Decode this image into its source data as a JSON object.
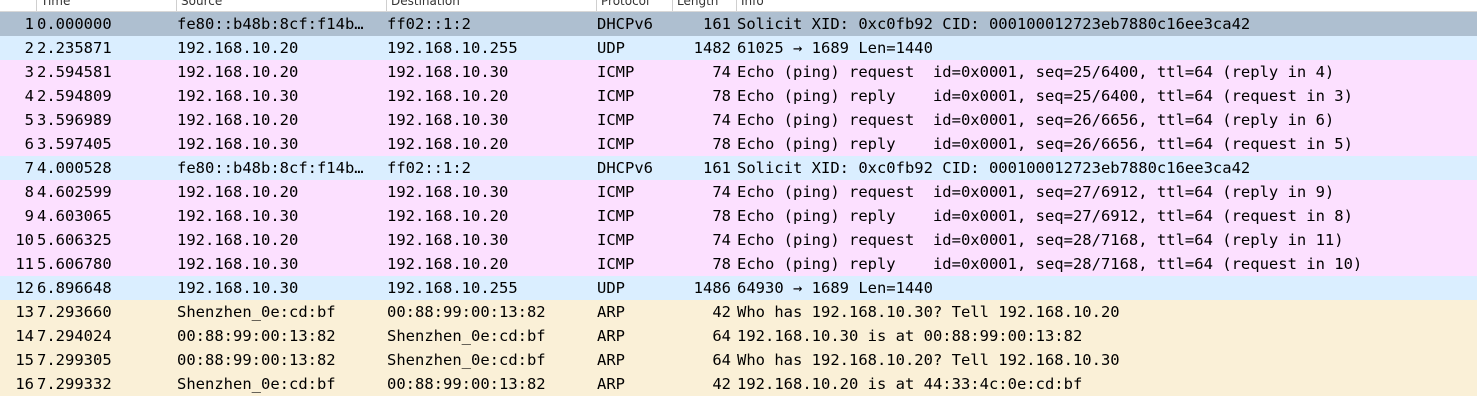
{
  "colors": {
    "dhcpv6_selected": "#aebfd0",
    "udp": "#daeeff",
    "icmp": "#fce0ff",
    "arp": "#faf0d7"
  },
  "columns": [
    "Time",
    "Source",
    "Destination",
    "Protocol",
    "Length",
    "Info"
  ],
  "rows": [
    {
      "no": "1",
      "time": "0.000000",
      "src": "fe80::b48b:8cf:f14b…",
      "dst": "ff02::1:2",
      "proto": "DHCPv6",
      "len": "161",
      "info": "Solicit XID: 0xc0fb92 CID: 000100012723eb7880c16ee3ca42",
      "color": "#aebfd0"
    },
    {
      "no": "2",
      "time": "2.235871",
      "src": "192.168.10.20",
      "dst": "192.168.10.255",
      "proto": "UDP",
      "len": "1482",
      "info": "61025 → 1689 Len=1440",
      "color": "#daeeff"
    },
    {
      "no": "3",
      "time": "2.594581",
      "src": "192.168.10.20",
      "dst": "192.168.10.30",
      "proto": "ICMP",
      "len": "74",
      "info": "Echo (ping) request  id=0x0001, seq=25/6400, ttl=64 (reply in 4)",
      "color": "#fce0ff"
    },
    {
      "no": "4",
      "time": "2.594809",
      "src": "192.168.10.30",
      "dst": "192.168.10.20",
      "proto": "ICMP",
      "len": "78",
      "info": "Echo (ping) reply    id=0x0001, seq=25/6400, ttl=64 (request in 3)",
      "color": "#fce0ff"
    },
    {
      "no": "5",
      "time": "3.596989",
      "src": "192.168.10.20",
      "dst": "192.168.10.30",
      "proto": "ICMP",
      "len": "74",
      "info": "Echo (ping) request  id=0x0001, seq=26/6656, ttl=64 (reply in 6)",
      "color": "#fce0ff"
    },
    {
      "no": "6",
      "time": "3.597405",
      "src": "192.168.10.30",
      "dst": "192.168.10.20",
      "proto": "ICMP",
      "len": "78",
      "info": "Echo (ping) reply    id=0x0001, seq=26/6656, ttl=64 (request in 5)",
      "color": "#fce0ff"
    },
    {
      "no": "7",
      "time": "4.000528",
      "src": "fe80::b48b:8cf:f14b…",
      "dst": "ff02::1:2",
      "proto": "DHCPv6",
      "len": "161",
      "info": "Solicit XID: 0xc0fb92 CID: 000100012723eb7880c16ee3ca42",
      "color": "#daeeff"
    },
    {
      "no": "8",
      "time": "4.602599",
      "src": "192.168.10.20",
      "dst": "192.168.10.30",
      "proto": "ICMP",
      "len": "74",
      "info": "Echo (ping) request  id=0x0001, seq=27/6912, ttl=64 (reply in 9)",
      "color": "#fce0ff"
    },
    {
      "no": "9",
      "time": "4.603065",
      "src": "192.168.10.30",
      "dst": "192.168.10.20",
      "proto": "ICMP",
      "len": "78",
      "info": "Echo (ping) reply    id=0x0001, seq=27/6912, ttl=64 (request in 8)",
      "color": "#fce0ff"
    },
    {
      "no": "10",
      "time": "5.606325",
      "src": "192.168.10.20",
      "dst": "192.168.10.30",
      "proto": "ICMP",
      "len": "74",
      "info": "Echo (ping) request  id=0x0001, seq=28/7168, ttl=64 (reply in 11)",
      "color": "#fce0ff"
    },
    {
      "no": "11",
      "time": "5.606780",
      "src": "192.168.10.30",
      "dst": "192.168.10.20",
      "proto": "ICMP",
      "len": "78",
      "info": "Echo (ping) reply    id=0x0001, seq=28/7168, ttl=64 (request in 10)",
      "color": "#fce0ff"
    },
    {
      "no": "12",
      "time": "6.896648",
      "src": "192.168.10.30",
      "dst": "192.168.10.255",
      "proto": "UDP",
      "len": "1486",
      "info": "64930 → 1689 Len=1440",
      "color": "#daeeff"
    },
    {
      "no": "13",
      "time": "7.293660",
      "src": "Shenzhen_0e:cd:bf",
      "dst": "00:88:99:00:13:82",
      "proto": "ARP",
      "len": "42",
      "info": "Who has 192.168.10.30? Tell 192.168.10.20",
      "color": "#faf0d7"
    },
    {
      "no": "14",
      "time": "7.294024",
      "src": "00:88:99:00:13:82",
      "dst": "Shenzhen_0e:cd:bf",
      "proto": "ARP",
      "len": "64",
      "info": "192.168.10.30 is at 00:88:99:00:13:82",
      "color": "#faf0d7"
    },
    {
      "no": "15",
      "time": "7.299305",
      "src": "00:88:99:00:13:82",
      "dst": "Shenzhen_0e:cd:bf",
      "proto": "ARP",
      "len": "64",
      "info": "Who has 192.168.10.20? Tell 192.168.10.30",
      "color": "#faf0d7"
    },
    {
      "no": "16",
      "time": "7.299332",
      "src": "Shenzhen_0e:cd:bf",
      "dst": "00:88:99:00:13:82",
      "proto": "ARP",
      "len": "42",
      "info": "192.168.10.20 is at 44:33:4c:0e:cd:bf",
      "color": "#faf0d7"
    }
  ]
}
